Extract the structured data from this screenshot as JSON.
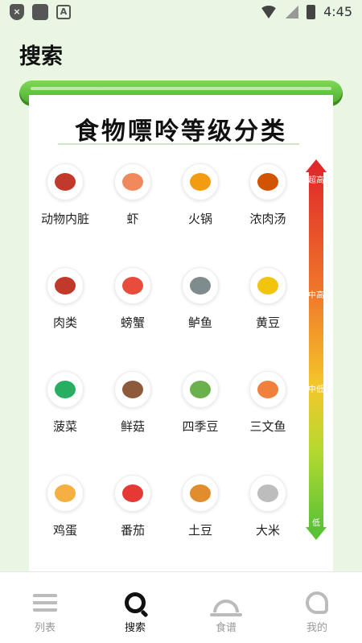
{
  "status_bar": {
    "time": "4:45"
  },
  "page_title": "搜索",
  "banner": {
    "title": "食物嘌呤等级分类"
  },
  "scale": {
    "levels": [
      "超高",
      "中高",
      "中低",
      "低"
    ],
    "top_color": "#e02a2a",
    "bottom_color": "#5bc236"
  },
  "foods": [
    {
      "label": "动物内脏",
      "icon": "liver-icon",
      "color": "#c0392b"
    },
    {
      "label": "虾",
      "icon": "shrimp-icon",
      "color": "#f08a5d"
    },
    {
      "label": "火锅",
      "icon": "hotpot-icon",
      "color": "#f39c12"
    },
    {
      "label": "浓肉汤",
      "icon": "soup-icon",
      "color": "#d35400"
    },
    {
      "label": "肉类",
      "icon": "meat-icon",
      "color": "#c0392b"
    },
    {
      "label": "螃蟹",
      "icon": "crab-icon",
      "color": "#e74c3c"
    },
    {
      "label": "鲈鱼",
      "icon": "fish-icon",
      "color": "#7f8c8d"
    },
    {
      "label": "黄豆",
      "icon": "soybean-icon",
      "color": "#f1c40f"
    },
    {
      "label": "菠菜",
      "icon": "spinach-icon",
      "color": "#27ae60"
    },
    {
      "label": "鲜菇",
      "icon": "mushroom-icon",
      "color": "#8d5a3b"
    },
    {
      "label": "四季豆",
      "icon": "greenbean-icon",
      "color": "#6ab04c"
    },
    {
      "label": "三文鱼",
      "icon": "salmon-icon",
      "color": "#f0803c"
    },
    {
      "label": "鸡蛋",
      "icon": "egg-icon",
      "color": "#f5b041"
    },
    {
      "label": "番茄",
      "icon": "tomato-icon",
      "color": "#e53935"
    },
    {
      "label": "土豆",
      "icon": "potato-icon",
      "color": "#e08e2b"
    },
    {
      "label": "大米",
      "icon": "rice-icon",
      "color": "#bdbdbd"
    }
  ],
  "bottom_nav": {
    "items": [
      {
        "label": "列表",
        "icon": "list-icon"
      },
      {
        "label": "搜索",
        "icon": "search-icon",
        "active": true
      },
      {
        "label": "食谱",
        "icon": "dish-icon"
      },
      {
        "label": "我的",
        "icon": "profile-icon"
      }
    ]
  }
}
